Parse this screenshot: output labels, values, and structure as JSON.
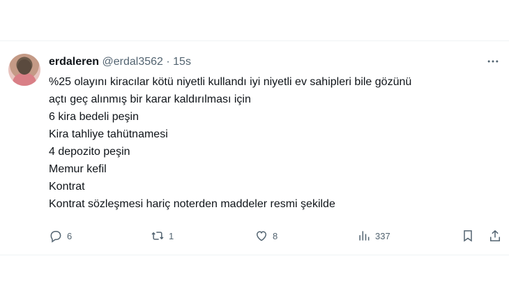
{
  "tweet": {
    "author_name": "erdaleren",
    "author_handle": "@erdal3562",
    "separator": "·",
    "time": "15s",
    "lines": [
      "%25 olayını kiracılar kötü niyetli kullandı iyi niyetli ev sahipleri bile gözünü",
      "açtı geç alınmış bir karar kaldırılması için",
      "6 kira bedeli peşin",
      "Kira tahliye tahütnamesi",
      "4 depozito peşin",
      "Memur kefil",
      "Kontrat",
      "Kontrat sözleşmesi hariç noterden maddeler resmi şekilde"
    ],
    "actions": {
      "replies": "6",
      "reposts": "1",
      "likes": "8",
      "views": "337"
    }
  },
  "icons": {
    "more": "more-icon",
    "reply": "reply-icon",
    "repost": "repost-icon",
    "like": "heart-icon",
    "views": "views-icon",
    "bookmark": "bookmark-icon",
    "share": "share-icon"
  }
}
